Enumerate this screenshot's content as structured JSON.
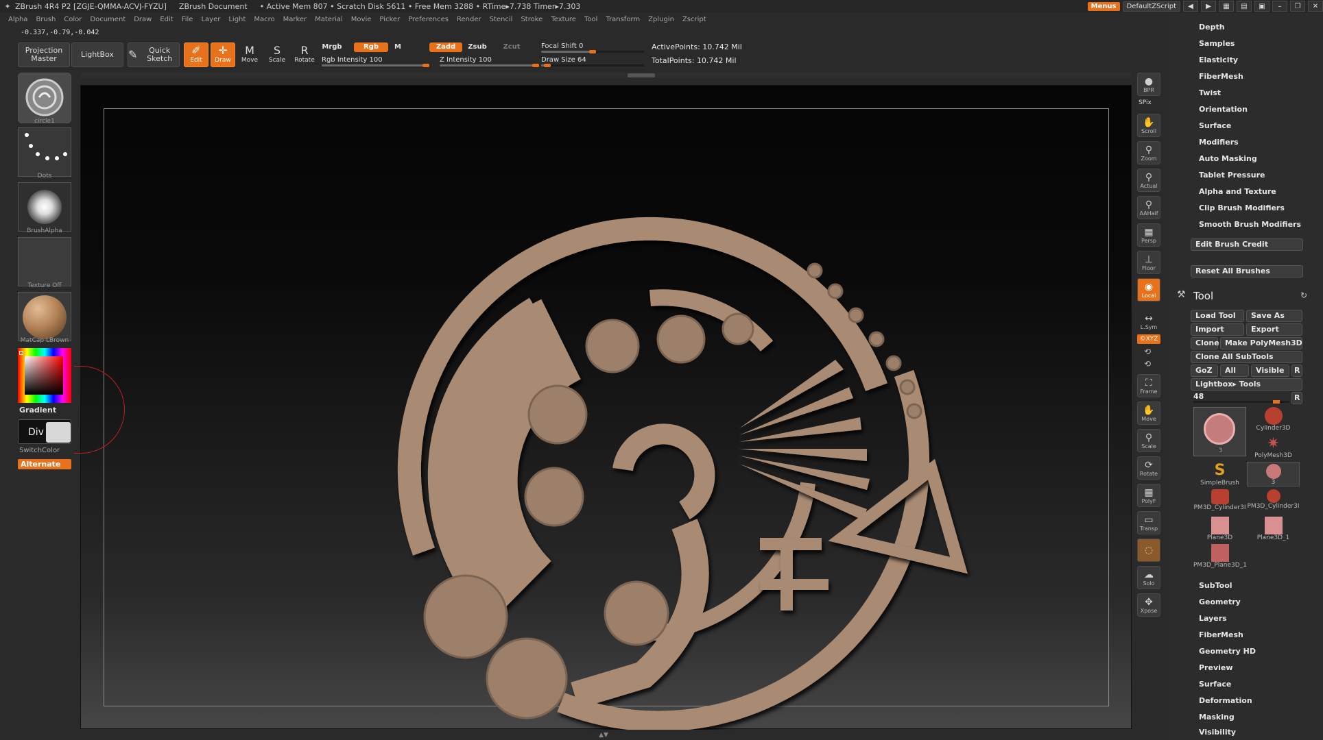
{
  "titlebar": {
    "app": "ZBrush 4R4 P2 [ZGJE-QMMA-ACVJ-FYZU]",
    "doc": "ZBrush Document",
    "mem": "• Active Mem 807 • Scratch Disk 5611 • Free Mem 3288 • RTime▸7.738 Timer▸7.303",
    "menus_label": "Menus",
    "script_label": "DefaultZScript"
  },
  "menubar": [
    "Alpha",
    "Brush",
    "Color",
    "Document",
    "Draw",
    "Edit",
    "File",
    "Layer",
    "Light",
    "Macro",
    "Marker",
    "Material",
    "Movie",
    "Picker",
    "Preferences",
    "Render",
    "Stencil",
    "Stroke",
    "Texture",
    "Tool",
    "Transform",
    "Zplugin",
    "Zscript"
  ],
  "coords": "-0.337,-0.79,-0.042",
  "toolbar": {
    "projection_master": "Projection Master",
    "lightbox": "LightBox",
    "quick_sketch": "Quick Sketch",
    "edit": "Edit",
    "draw": "Draw",
    "move": "Move",
    "scale": "Scale",
    "rotate": "Rotate",
    "mrgb": "Mrgb",
    "rgb": "Rgb",
    "m": "M",
    "zadd": "Zadd",
    "zsub": "Zsub",
    "zcut": "Zcut",
    "rgb_intensity_label": "Rgb Intensity",
    "rgb_intensity": "100",
    "rgb_intensity_value": 100,
    "z_intensity_label": "Z Intensity",
    "z_intensity": "100",
    "z_intensity_value": 100,
    "focal_shift_label": "Focal Shift",
    "focal_shift": "0",
    "focal_shift_value": 0,
    "draw_size_label": "Draw Size",
    "draw_size": "64",
    "draw_size_value": 64,
    "active_points": "ActivePoints: 10.742 Mil",
    "total_points": "TotalPoints: 10.742 Mil"
  },
  "left_tray": {
    "brush": "circle1",
    "stroke": "Dots",
    "alpha": "BrushAlpha",
    "texture": "Texture Off",
    "material": "MatCap LBrown",
    "gradient": "Gradient",
    "switchcolor": "SwitchColor",
    "alternate": "Alternate",
    "div": "Div"
  },
  "right_strip": [
    {
      "name": "bpr",
      "label": "BPR"
    },
    {
      "name": "spix",
      "label": "SPix"
    },
    {
      "name": "scroll",
      "label": "Scroll"
    },
    {
      "name": "zoom",
      "label": "Zoom"
    },
    {
      "name": "actual",
      "label": "Actual"
    },
    {
      "name": "aahalf",
      "label": "AAHalf"
    },
    {
      "name": "persp",
      "label": "Persp"
    },
    {
      "name": "floor",
      "label": "Floor"
    },
    {
      "name": "local",
      "label": "Local"
    },
    {
      "name": "lsym",
      "label": "L.Sym"
    },
    {
      "name": "xyz",
      "label": "©XYZ"
    },
    {
      "name": "frame",
      "label": "Frame"
    },
    {
      "name": "move",
      "label": "Move"
    },
    {
      "name": "scale",
      "label": "Scale"
    },
    {
      "name": "rotate",
      "label": "Rotate"
    },
    {
      "name": "polyf",
      "label": "PolyF"
    },
    {
      "name": "transp",
      "label": "Transp"
    },
    {
      "name": "solo",
      "label": "Solo"
    },
    {
      "name": "xpose",
      "label": "Xpose"
    }
  ],
  "right_panel": {
    "brush_menu": [
      "Depth",
      "Samples",
      "Elasticity",
      "FiberMesh",
      "Twist",
      "Orientation",
      "Surface",
      "Modifiers",
      "Auto Masking",
      "Tablet Pressure",
      "Alpha and Texture",
      "Clip Brush Modifiers",
      "Smooth Brush Modifiers"
    ],
    "edit_brush_credit": "Edit Brush Credit",
    "reset_all_brushes": "Reset All Brushes",
    "tool_title": "Tool",
    "load_tool": "Load Tool",
    "save_as": "Save As",
    "import": "Import",
    "export": "Export",
    "clone": "Clone",
    "make_polymesh": "Make PolyMesh3D",
    "clone_all_subtools": "Clone All SubTools",
    "goz": "GoZ",
    "all": "All",
    "visible": "Visible",
    "r": "R",
    "lightbox_tools": "Lightbox▸ Tools",
    "tool_count": "48",
    "tools": [
      {
        "name": "3",
        "color": "#c87a7a"
      },
      {
        "name": "Cylinder3D",
        "color": "#b84030"
      },
      {
        "name": "PolyMesh3D",
        "color": "#c85050"
      },
      {
        "name": "SimpleBrush",
        "color": "#e0a020"
      },
      {
        "name": "3",
        "color": "#c87a7a"
      },
      {
        "name": "PM3D_Cylinder3I",
        "color": "#b84030"
      },
      {
        "name": "PM3D_Cylinder3I",
        "color": "#b84030"
      },
      {
        "name": "Plane3D",
        "color": "#d89090"
      },
      {
        "name": "Plane3D_1",
        "color": "#d89090"
      },
      {
        "name": "PM3D_Plane3D_1",
        "color": "#c06060"
      }
    ],
    "tool_menu": [
      "SubTool",
      "Geometry",
      "Layers",
      "FiberMesh",
      "Geometry HD",
      "Preview",
      "Surface",
      "Deformation",
      "Masking",
      "Visibility"
    ]
  }
}
